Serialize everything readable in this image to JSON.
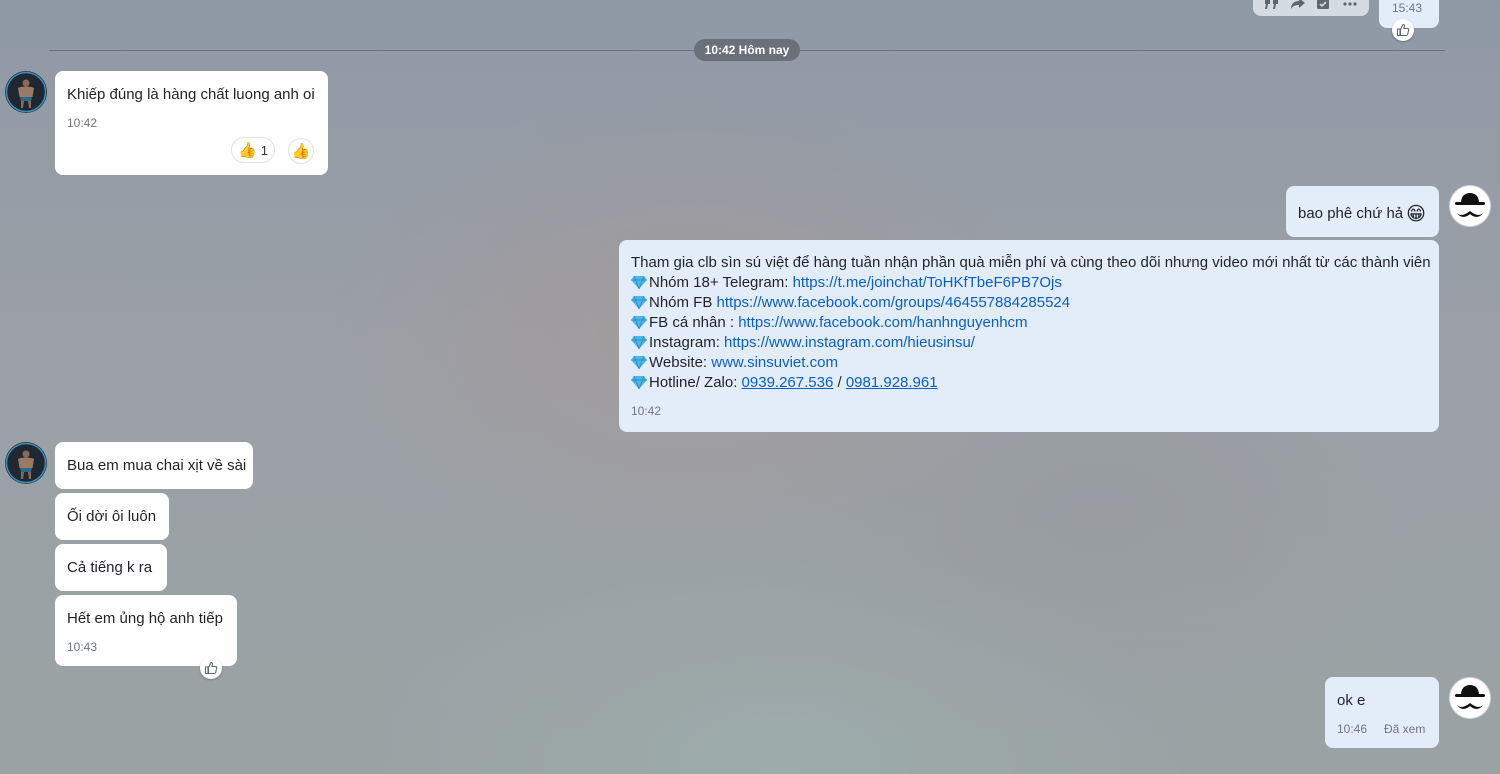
{
  "top": {
    "time": "15:43"
  },
  "divider": {
    "label": "10:42 Hôm nay"
  },
  "messages": {
    "m1": {
      "text": "Khiếp đúng là hàng chất luong anh oi",
      "time": "10:42",
      "reaction_count": "1"
    },
    "m2": {
      "text": "bao phê chứ hả",
      "emoji": "😁"
    },
    "m3": {
      "intro": "Tham gia clb sìn sú việt để hàng tuần nhận phần quà miễn phí và cùng theo dõi nhưng video mới nhất từ các thành viên",
      "lines": [
        {
          "label": "Nhóm 18+ Telegram: ",
          "link": "https://t.me/joinchat/ToHKfTbeF6PB7Ojs"
        },
        {
          "label": "Nhóm FB ",
          "link": "https://www.facebook.com/groups/464557884285524"
        },
        {
          "label": "FB cá nhân : ",
          "link": "https://www.facebook.com/hanhnguyenhcm"
        },
        {
          "label": "Instagram: ",
          "link": "https://www.instagram.com/hieusinsu/"
        },
        {
          "label": "Website: ",
          "link": "www.sinsuviet.com"
        }
      ],
      "hotline": {
        "label": "Hotline/ Zalo: ",
        "phone1": "0939.267.536",
        "sep": " / ",
        "phone2": "0981.928.961"
      },
      "time": "10:42"
    },
    "m4": {
      "text": "Bua em mua chai xịt về sài"
    },
    "m5": {
      "text": "Ối dời ôi luôn"
    },
    "m6": {
      "text": "Cả tiếng k ra"
    },
    "m7": {
      "text": "Hết em ủng hộ anh tiếp",
      "time": "10:43"
    },
    "m8": {
      "text": "ok e",
      "time": "10:46",
      "status": "Đã xem"
    }
  },
  "colors": {
    "my_bubble": "#e3edf9",
    "their_bubble": "#ffffff",
    "link": "#0b5fc9",
    "divider_pill": "#6a7079"
  }
}
